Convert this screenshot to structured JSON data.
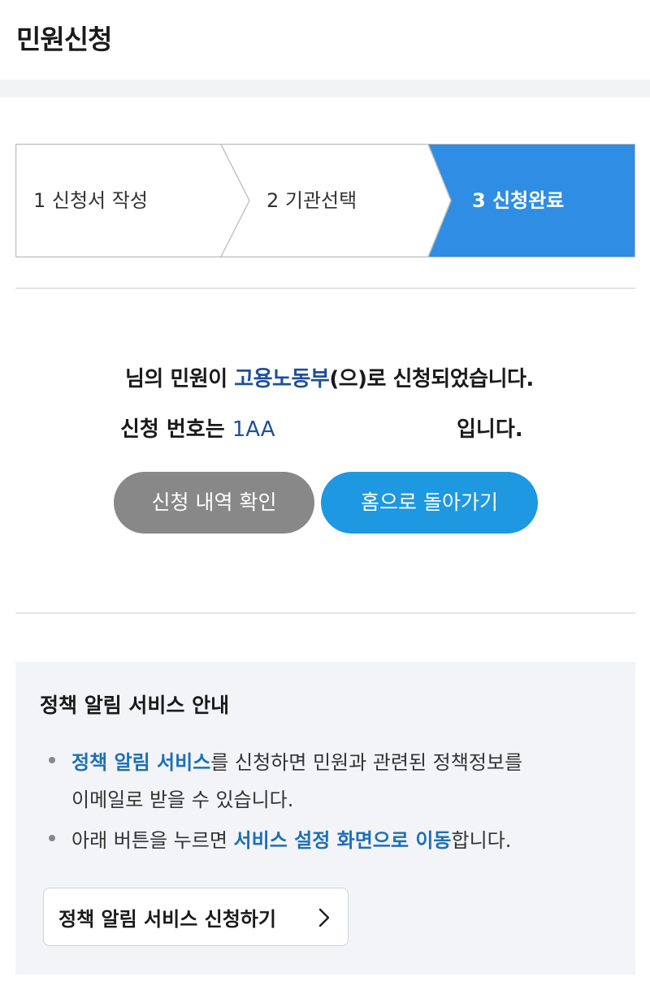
{
  "header": {
    "title": "민원신청"
  },
  "stepper": {
    "steps": [
      {
        "label": "1 신청서 작성"
      },
      {
        "label": "2 기관선택"
      },
      {
        "label": "3 신청완료"
      }
    ],
    "active_index": 2,
    "active_color": "#2f8de4"
  },
  "result": {
    "line1_prefix": "님의 민원이 ",
    "agency": "고용노동부",
    "line1_suffix": "(으)로 신청되었습니다.",
    "line2_prefix": "신청 번호는 ",
    "application_number": "1AA",
    "line2_suffix": "입니다."
  },
  "buttons": {
    "history_label": "신청 내역 확인",
    "home_label": "홈으로 돌아가기"
  },
  "notice": {
    "title": "정책 알림 서비스 안내",
    "item1_link": "정책 알림 서비스",
    "item1_text_a": "를 신청하면 민원과 관련된 정책정보를",
    "item1_text_b": "이메일로 받을 수 있습니다.",
    "item2_text_a": "아래 버튼을 누르면 ",
    "item2_link": "서비스 설정 화면으로 이동",
    "item2_text_b": "합니다.",
    "apply_button_label": "정책 알림 서비스 신청하기",
    "apply_button_icon": "chevron-right-icon"
  },
  "colors": {
    "home_button": "#1e98e0",
    "history_button": "#888888",
    "accent_text": "#1e4f9c",
    "link_text": "#1d6fb8"
  }
}
